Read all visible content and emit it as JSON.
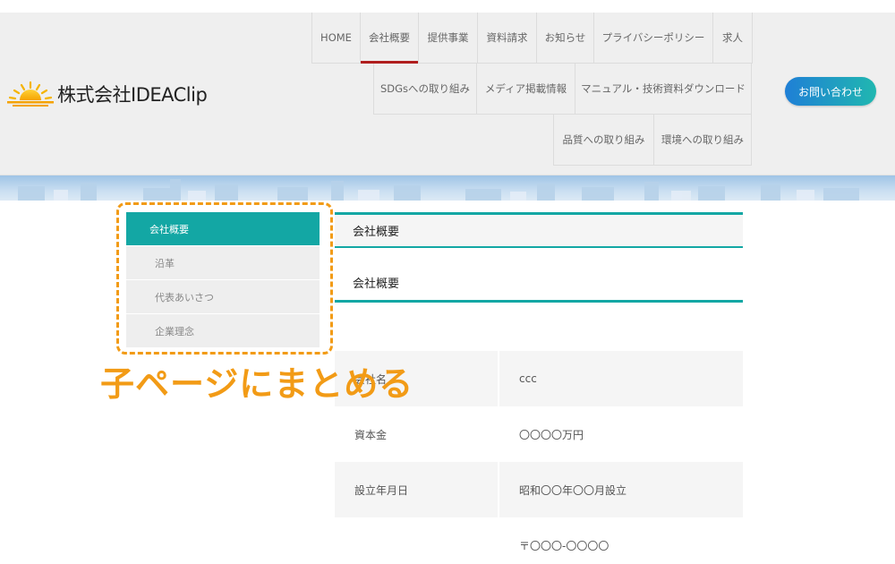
{
  "header": {
    "logo_text": "株式会社IDEAClip",
    "nav_row1": [
      "HOME",
      "会社概要",
      "提供事業",
      "資料請求",
      "お知らせ",
      "プライバシーポリシー",
      "求人"
    ],
    "nav_row2": [
      "SDGsへの取り組み",
      "メディア掲載情報",
      "マニュアル・技術資料ダウンロード"
    ],
    "nav_row3": [
      "品質への取り組み",
      "環境への取り組み"
    ],
    "active_nav": "会社概要",
    "contact_label": "お問い合わせ"
  },
  "side_menu": {
    "items": [
      "会社概要",
      "沿革",
      "代表あいさつ",
      "企業理念"
    ]
  },
  "annotation": "子ページにまとめる",
  "content": {
    "page_heading": "会社概要",
    "section_heading": "会社概要",
    "rows": [
      {
        "label": "会社名",
        "value": "ccc"
      },
      {
        "label": "資本金",
        "value": "〇〇〇〇万円"
      },
      {
        "label": "設立年月日",
        "value": "昭和〇〇年〇〇月設立"
      },
      {
        "label": "",
        "value": "〒〇〇〇-〇〇〇〇"
      }
    ]
  },
  "colors": {
    "accent": "#13a7a4",
    "annotation": "#f29b16",
    "nav_active": "#b01e1e"
  }
}
